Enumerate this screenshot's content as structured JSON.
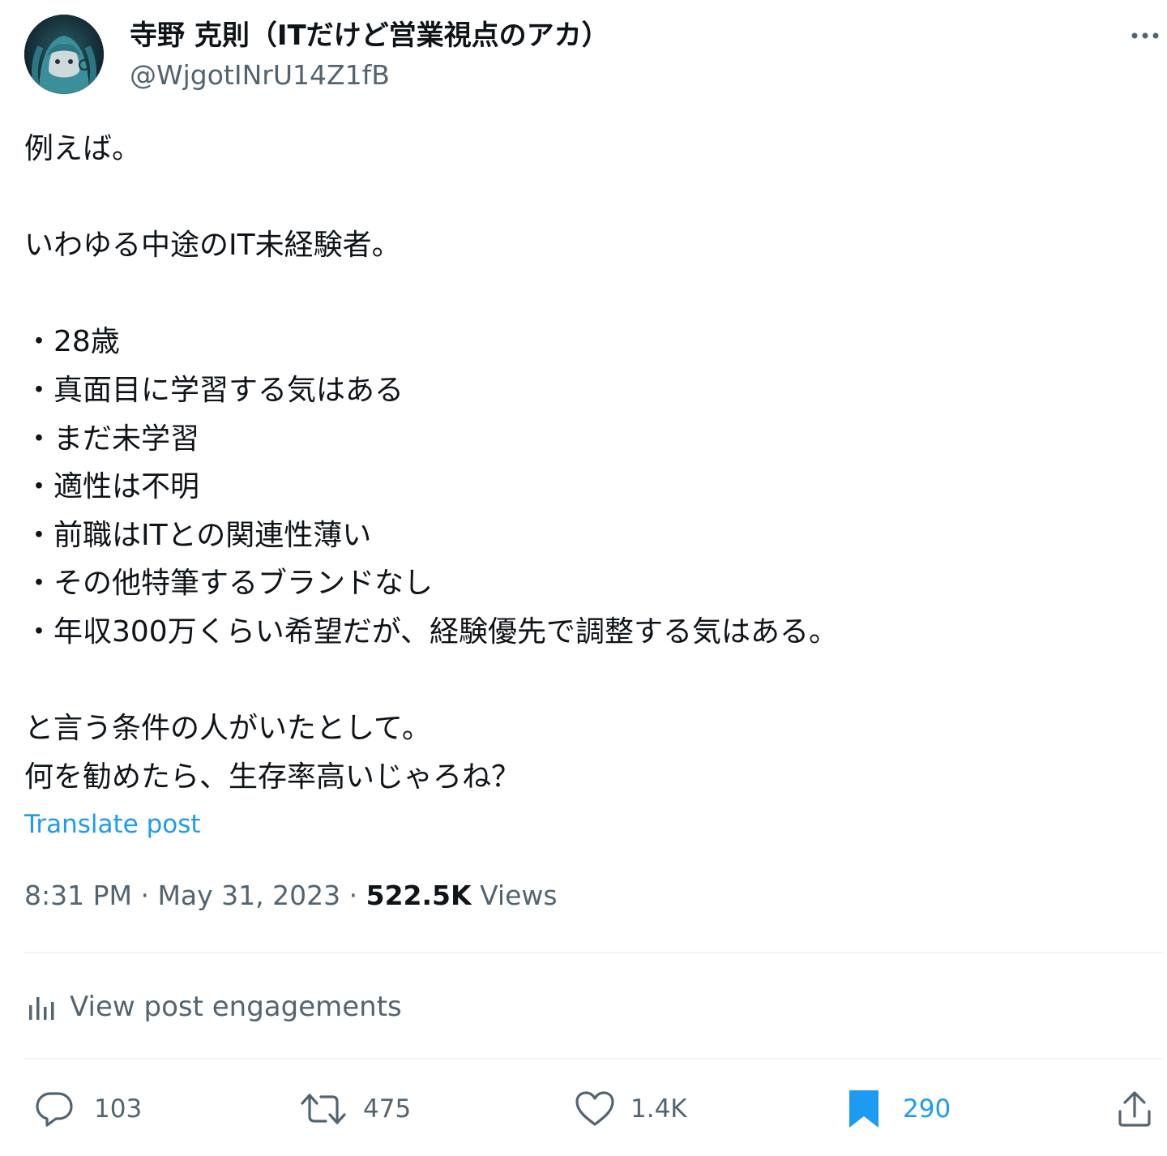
{
  "author": {
    "display_name": "寺野 克則（ITだけど営業視点のアカ）",
    "handle": "@WjgotINrU14Z1fB"
  },
  "post": {
    "text": "例えば。\n\nいわゆる中途のIT未経験者。\n\n・28歳\n・真面目に学習する気はある\n・まだ未学習\n・適性は不明\n・前職はITとの関連性薄い\n・その他特筆するブランドなし\n・年収300万くらい希望だが、経験優先で調整する気はある。\n\nと言う条件の人がいたとして。\n何を勧めたら、生存率高いじゃろね？",
    "translate_label": "Translate post"
  },
  "meta": {
    "time": "8:31 PM",
    "separator": " · ",
    "date": "May 31, 2023",
    "views_count": "522.5K",
    "views_label": "Views"
  },
  "engagements": {
    "label": "View post engagements"
  },
  "actions": {
    "replies": "103",
    "reposts": "475",
    "likes": "1.4K",
    "bookmarks": "290"
  },
  "colors": {
    "text": "#0f1419",
    "secondary": "#536471",
    "accent": "#1d9bf0",
    "divider": "#eff3f4"
  },
  "icons": {
    "more": "more-horizontal-icon",
    "engagements": "bar-chart-icon",
    "reply": "reply-bubble-icon",
    "repost": "repost-arrows-icon",
    "like": "heart-icon",
    "bookmark": "bookmark-filled-icon",
    "share": "share-upload-icon"
  }
}
